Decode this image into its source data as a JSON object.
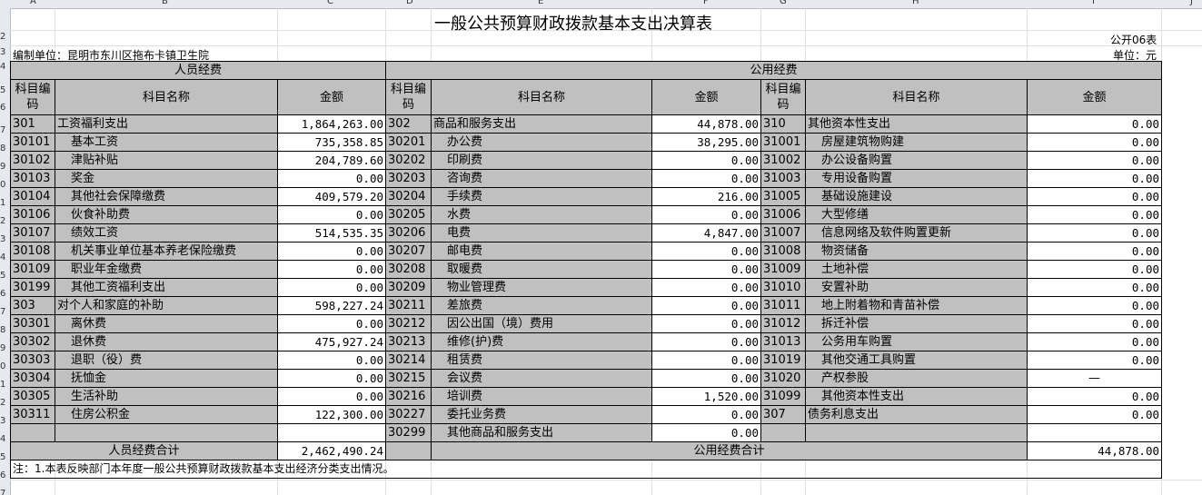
{
  "sheet": {
    "column_letters": [
      "A",
      "B",
      "C",
      "D",
      "E",
      "F",
      "G",
      "H",
      "I",
      "J"
    ],
    "row_numbers": [
      "2",
      "3",
      "4",
      "5",
      "6",
      "7",
      "8",
      "9",
      "0",
      "1",
      "2",
      "3",
      "4",
      "5",
      "6",
      "7",
      "8",
      "9",
      "0",
      "1",
      "2",
      "3",
      "4",
      "5",
      "6",
      "7"
    ]
  },
  "report": {
    "title": "一般公共预算财政拨款基本支出决算表",
    "form_no": "公开06表",
    "unit_label": "编制单位：昆明市东川区拖布卡镇卫生院",
    "currency": "单位：元"
  },
  "headers": {
    "personnel": "人员经费",
    "public": "公用经费",
    "code": "科目编码",
    "name": "科目名称",
    "amount": "金额"
  },
  "rows": [
    {
      "p_code": "301",
      "p_name": "工资福利支出",
      "p_amt": "1,864,263.00",
      "u_code": "302",
      "u_name": "商品和服务支出",
      "u_amt": "44,878.00",
      "o_code": "310",
      "o_name": "其他资本性支出",
      "o_amt": "0.00"
    },
    {
      "p_code": "30101",
      "p_name": "基本工资",
      "p_amt": "735,358.85",
      "u_code": "30201",
      "u_name": "办公费",
      "u_amt": "38,295.00",
      "o_code": "31001",
      "o_name": "房屋建筑物购建",
      "o_amt": "0.00"
    },
    {
      "p_code": "30102",
      "p_name": "津贴补贴",
      "p_amt": "204,789.60",
      "u_code": "30202",
      "u_name": "印刷费",
      "u_amt": "0.00",
      "o_code": "31002",
      "o_name": "办公设备购置",
      "o_amt": "0.00"
    },
    {
      "p_code": "30103",
      "p_name": "奖金",
      "p_amt": "0.00",
      "u_code": "30203",
      "u_name": "咨询费",
      "u_amt": "0.00",
      "o_code": "31003",
      "o_name": "专用设备购置",
      "o_amt": "0.00"
    },
    {
      "p_code": "30104",
      "p_name": "其他社会保障缴费",
      "p_amt": "409,579.20",
      "u_code": "30204",
      "u_name": "手续费",
      "u_amt": "216.00",
      "o_code": "31005",
      "o_name": "基础设施建设",
      "o_amt": "0.00"
    },
    {
      "p_code": "30106",
      "p_name": "伙食补助费",
      "p_amt": "0.00",
      "u_code": "30205",
      "u_name": "水费",
      "u_amt": "0.00",
      "o_code": "31006",
      "o_name": "大型修缮",
      "o_amt": "0.00"
    },
    {
      "p_code": "30107",
      "p_name": "绩效工资",
      "p_amt": "514,535.35",
      "u_code": "30206",
      "u_name": "电费",
      "u_amt": "4,847.00",
      "o_code": "31007",
      "o_name": "信息网络及软件购置更新",
      "o_amt": "0.00"
    },
    {
      "p_code": "30108",
      "p_name": "机关事业单位基本养老保险缴费",
      "p_amt": "0.00",
      "u_code": "30207",
      "u_name": "邮电费",
      "u_amt": "0.00",
      "o_code": "31008",
      "o_name": "物资储备",
      "o_amt": "0.00"
    },
    {
      "p_code": "30109",
      "p_name": "职业年金缴费",
      "p_amt": "0.00",
      "u_code": "30208",
      "u_name": "取暖费",
      "u_amt": "0.00",
      "o_code": "31009",
      "o_name": "土地补偿",
      "o_amt": "0.00"
    },
    {
      "p_code": "30199",
      "p_name": "其他工资福利支出",
      "p_amt": "0.00",
      "u_code": "30209",
      "u_name": "物业管理费",
      "u_amt": "0.00",
      "o_code": "31010",
      "o_name": "安置补助",
      "o_amt": "0.00"
    },
    {
      "p_code": "303",
      "p_name": "对个人和家庭的补助",
      "p_amt": "598,227.24",
      "u_code": "30211",
      "u_name": "差旅费",
      "u_amt": "0.00",
      "o_code": "31011",
      "o_name": "地上附着物和青苗补偿",
      "o_amt": "0.00"
    },
    {
      "p_code": "30301",
      "p_name": "离休费",
      "p_amt": "0.00",
      "u_code": "30212",
      "u_name": "因公出国（境）费用",
      "u_amt": "0.00",
      "o_code": "31012",
      "o_name": "拆迁补偿",
      "o_amt": "0.00"
    },
    {
      "p_code": "30302",
      "p_name": "退休费",
      "p_amt": "475,927.24",
      "u_code": "30213",
      "u_name": "维修(护)费",
      "u_amt": "0.00",
      "o_code": "31013",
      "o_name": "公务用车购置",
      "o_amt": "0.00"
    },
    {
      "p_code": "30303",
      "p_name": "退职（役）费",
      "p_amt": "0.00",
      "u_code": "30214",
      "u_name": "租赁费",
      "u_amt": "0.00",
      "o_code": "31019",
      "o_name": "其他交通工具购置",
      "o_amt": "0.00"
    },
    {
      "p_code": "30304",
      "p_name": "抚恤金",
      "p_amt": "0.00",
      "u_code": "30215",
      "u_name": "会议费",
      "u_amt": "0.00",
      "o_code": "31020",
      "o_name": "产权参股",
      "o_amt": "—"
    },
    {
      "p_code": "30305",
      "p_name": "生活补助",
      "p_amt": "0.00",
      "u_code": "30216",
      "u_name": "培训费",
      "u_amt": "1,520.00",
      "o_code": "31099",
      "o_name": "其他资本性支出",
      "o_amt": "0.00"
    },
    {
      "p_code": "30311",
      "p_name": "住房公积金",
      "p_amt": "122,300.00",
      "u_code": "30227",
      "u_name": "委托业务费",
      "u_amt": "0.00",
      "o_code": "307",
      "o_name": "债务利息支出",
      "o_amt": "0.00"
    },
    {
      "p_code": "",
      "p_name": "",
      "p_amt": "",
      "u_code": "30299",
      "u_name": "其他商品和服务支出",
      "u_amt": "0.00",
      "o_code": "",
      "o_name": "",
      "o_amt": ""
    }
  ],
  "totals": {
    "personnel_label": "人员经费合计",
    "personnel_amt": "2,462,490.24",
    "public_label": "公用经费合计",
    "public_amt": "44,878.00"
  },
  "note": "注：1.本表反映部门本年度一般公共预算财政拨款基本支出经济分类支出情况。"
}
